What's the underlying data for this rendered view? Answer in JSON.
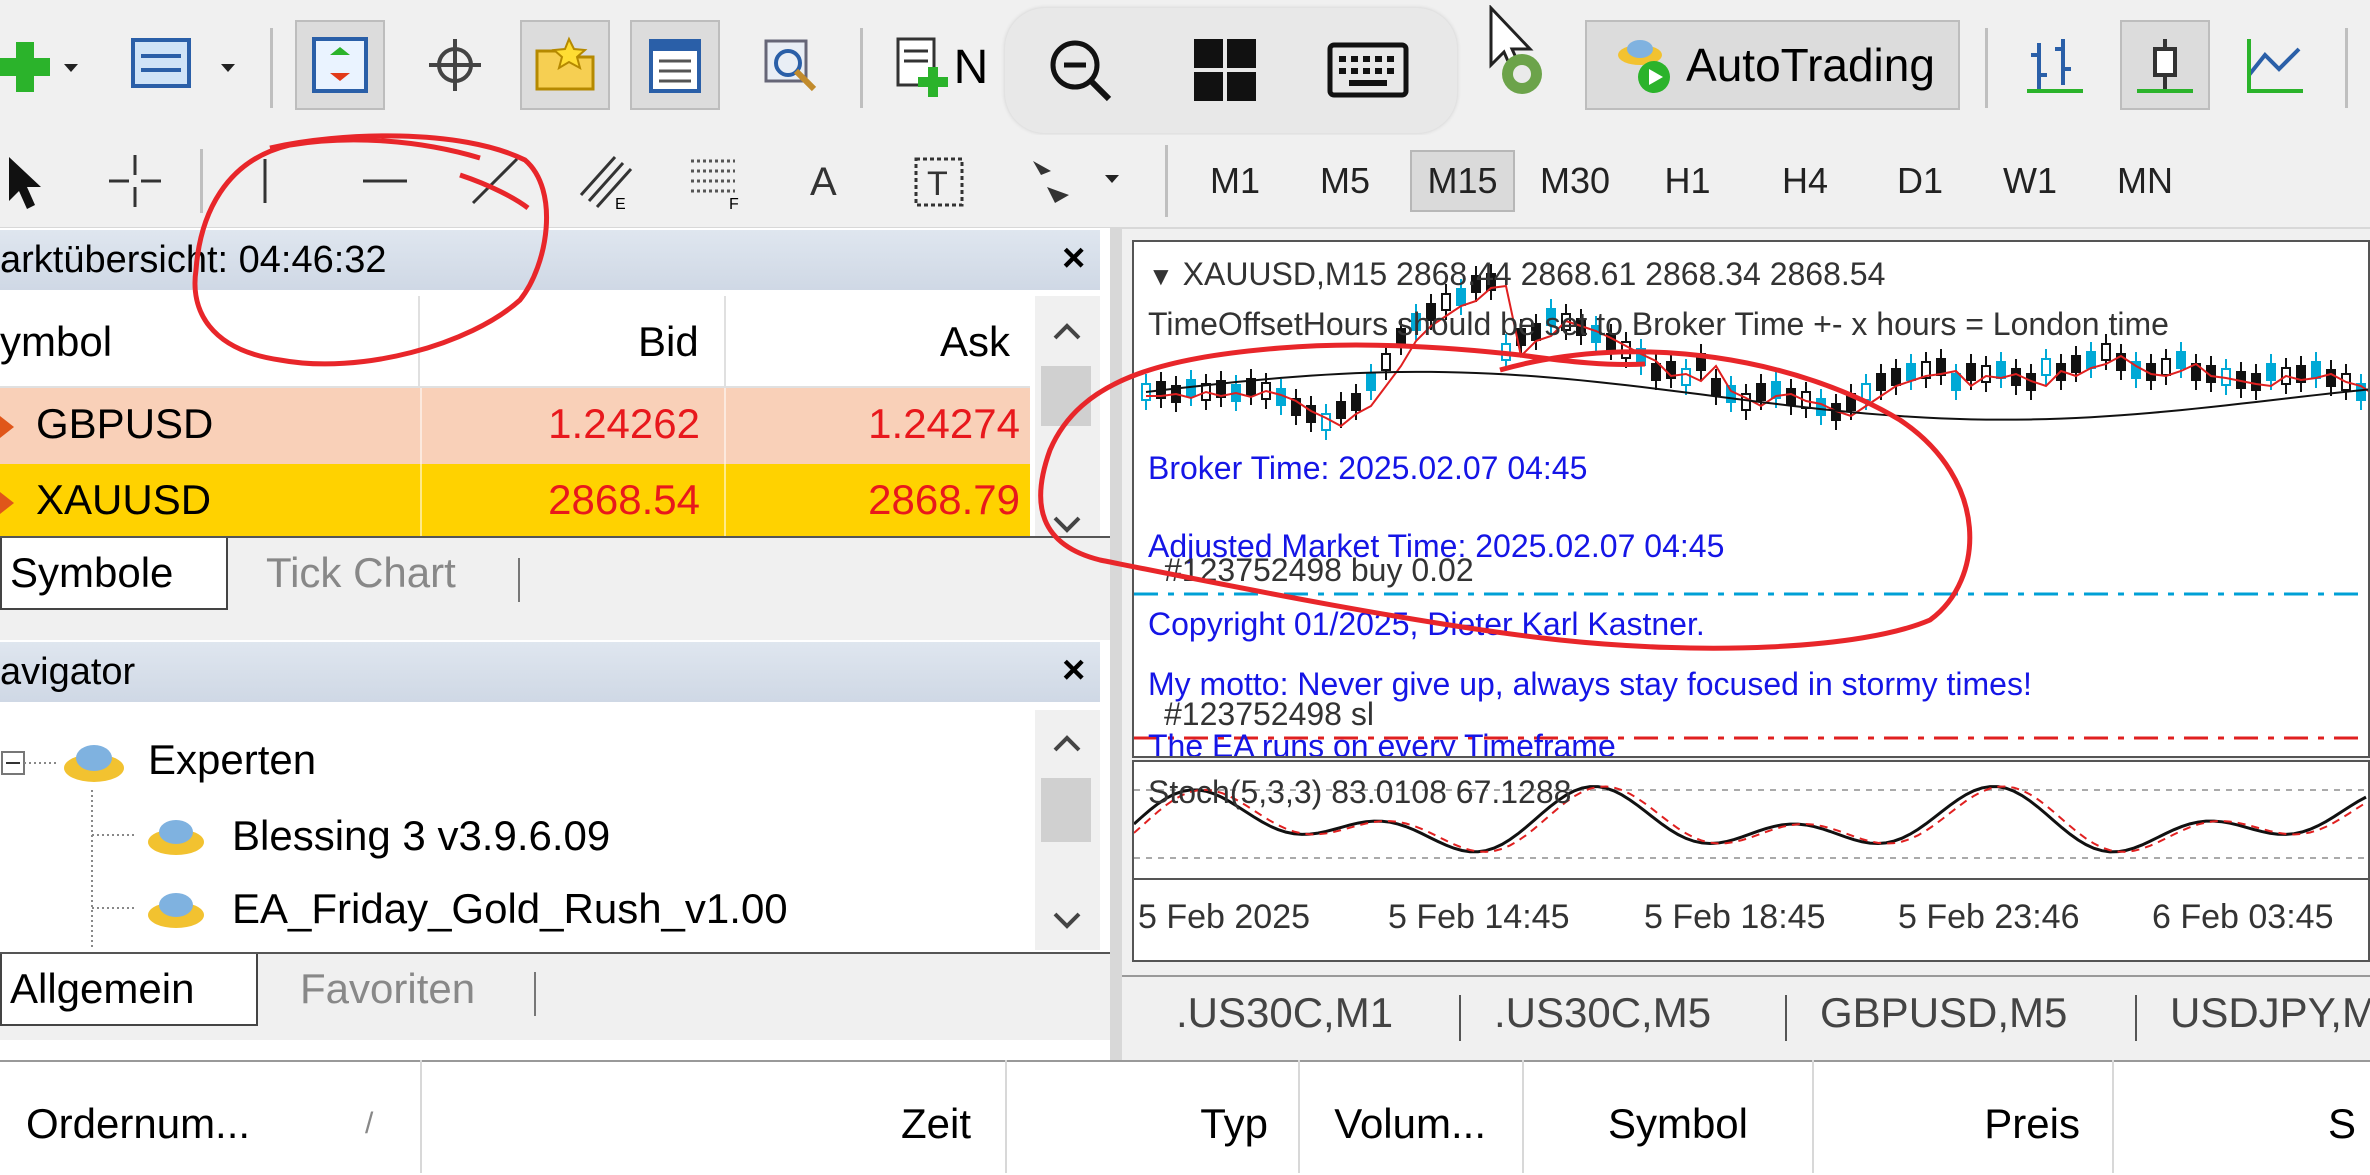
{
  "toolbar": {
    "new_order_label": "N",
    "autotrading_label": "AutoTrading"
  },
  "timeframes": [
    "M1",
    "M5",
    "M15",
    "M30",
    "H1",
    "H4",
    "D1",
    "W1",
    "MN"
  ],
  "timeframe_selected": "M15",
  "market_watch": {
    "title": "arktübersicht: 04:46:32",
    "columns": {
      "symbol": "ymbol",
      "bid": "Bid",
      "ask": "Ask"
    },
    "rows": [
      {
        "symbol": "GBPUSD",
        "bid": "1.24262",
        "ask": "1.24274",
        "bg": "#f9d0b8"
      },
      {
        "symbol": "XAUUSD",
        "bid": "2868.54",
        "ask": "2868.79",
        "bg": "#ffd200"
      }
    ],
    "tabs": {
      "active": "Symbole",
      "inactive": "Tick Chart"
    }
  },
  "navigator": {
    "title": "avigator",
    "root": "Experten",
    "items": [
      "Blessing 3 v3.9.6.09",
      "EA_Friday_Gold_Rush_v1.00"
    ],
    "tabs": {
      "active": "Allgemein",
      "inactive": "Favoriten"
    }
  },
  "chart": {
    "header": "XAUUSD,M15  2868.44 2868.61 2868.34 2868.54",
    "note1": "TimeOffsetHours should be set to Broker Time +- x hours = London time",
    "broker_time": "Broker Time: 2025.02.07 04:45",
    "market_time": "Adjusted Market Time: 2025.02.07 04:45",
    "order_label": "#123752498 buy 0.02",
    "copyright": "Copyright 01/2025, Dieter Karl Kastner.",
    "motto": "My motto: Never give up, always stay focused in stormy times!",
    "sl_label": "#123752498 sl",
    "footer": "The EA runs on every Timeframe",
    "indicator": "Stoch(5,3,3) 83.0108 67.1288",
    "time_axis": [
      "5 Feb 2025",
      "5 Feb 14:45",
      "5 Feb 18:45",
      "5 Feb 23:46",
      "6 Feb 03:45"
    ]
  },
  "chart_tabs": [
    ".US30C,M1",
    ".US30C,M5",
    "GBPUSD,M5",
    "USDJPY,M"
  ],
  "orders": {
    "columns": [
      "Ordernum...",
      "/",
      "Zeit",
      "Typ",
      "Volum...",
      "Symbol",
      "Preis",
      "S"
    ]
  },
  "colors": {
    "annotation": "#e8262a",
    "bid_ask_text": "#e8181c",
    "chart_text": "#1515e6"
  }
}
